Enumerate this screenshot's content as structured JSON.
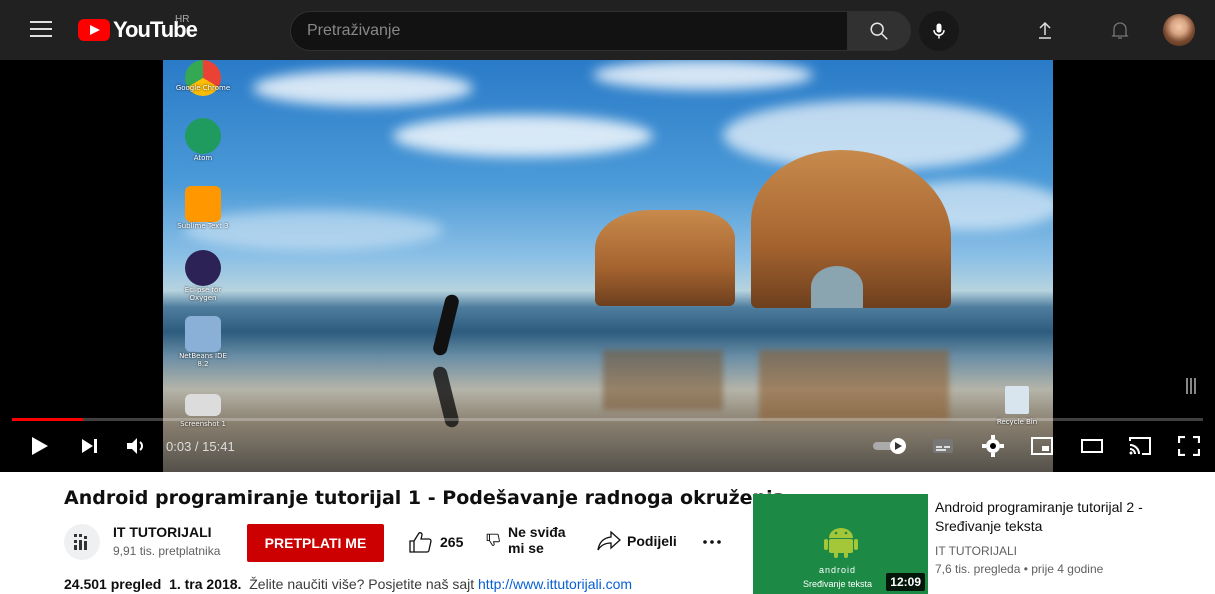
{
  "header": {
    "logo_text": "YouTube",
    "region": "HR",
    "search_placeholder": "Pretraživanje",
    "icons": [
      "menu-icon",
      "search-icon",
      "mic-icon",
      "upload-icon",
      "bell-icon",
      "avatar"
    ]
  },
  "player": {
    "current_time": "0:03",
    "duration": "15:41",
    "time_display": "0:03 / 15:41",
    "progress_fraction": 0.0032,
    "buffered_fraction": 0.056,
    "desktop_icons": [
      {
        "label": "Google Chrome"
      },
      {
        "label": "Atom"
      },
      {
        "label": "Sublime Text 3"
      },
      {
        "label": "Eclipse for Oxygen"
      },
      {
        "label": "NetBeans IDE 8.2"
      },
      {
        "label": "Screenshot 1"
      }
    ],
    "recycle_bin_label": "Recycle Bin",
    "autoplay_on": true,
    "colors": {
      "progress": "#ff0000"
    }
  },
  "video": {
    "title": "Android programiranje tutorijal 1 - Podešavanje radnoga okruženja",
    "channel_name": "IT TUTORIJALI",
    "channel_subs": "9,91 tis. pretplatnika",
    "subscribe_label": "PRETPLATI ME",
    "likes": "265",
    "dislike_label_line1": "Ne sviđa",
    "dislike_label_line2": "mi se",
    "share_label": "Podijeli",
    "views": "24.501 pregled",
    "date": "1. tra 2018.",
    "description": "Želite naučiti više? Posjetite naš sajt",
    "link": "http://www.ittutorijali.com"
  },
  "suggested": {
    "title": "Android programiranje tutorijal 2 - Sređivanje teksta",
    "channel": "IT TUTORIJALI",
    "meta": "7,6 tis. pregleda • prije 4 godine",
    "duration": "12:09",
    "thumb_caption": "Sređivanje teksta",
    "thumb_brand": "android",
    "thumb_color": "#1c8a45"
  }
}
